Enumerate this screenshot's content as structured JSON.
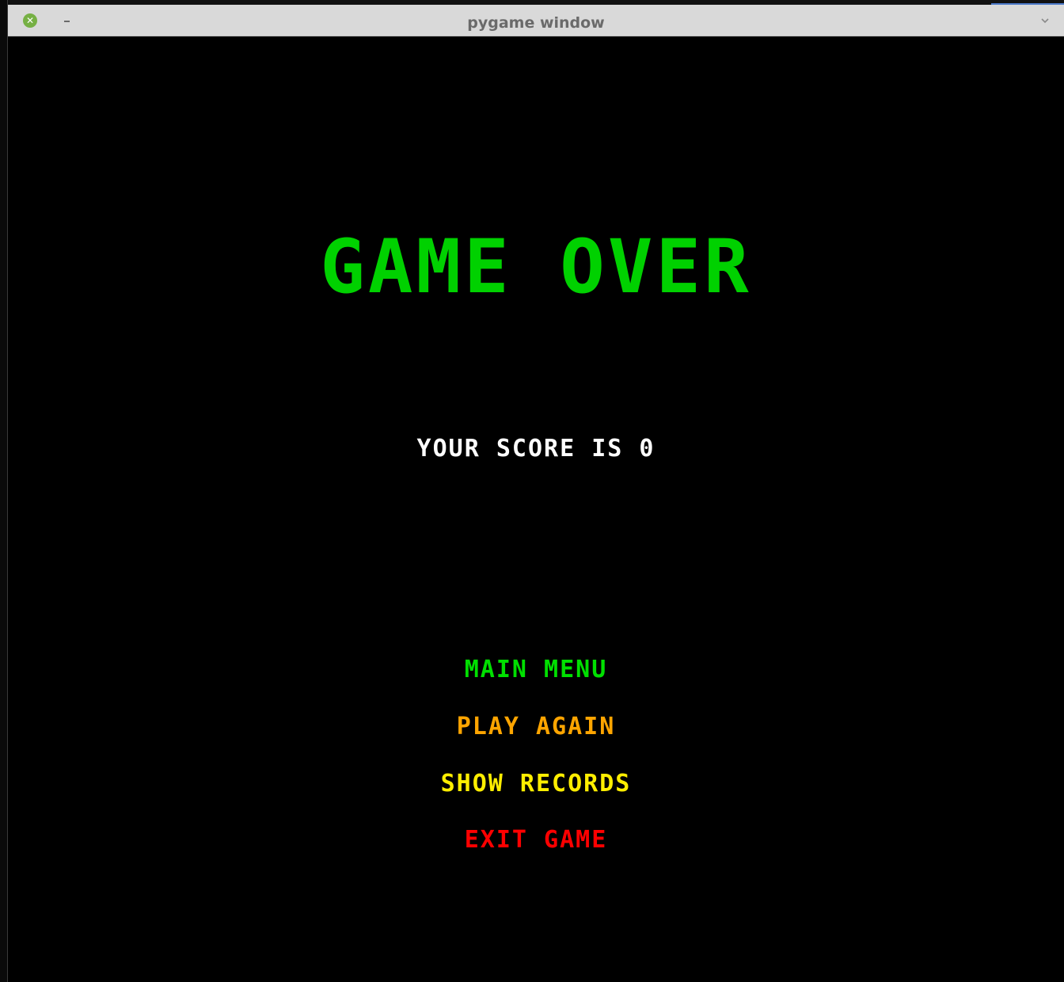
{
  "window": {
    "title": "pygame window"
  },
  "titlebar": {
    "close_icon": "close-circle-icon",
    "close_glyph": "✕",
    "minimize_icon": "minimize-icon",
    "menu_icon": "chevron-down-icon"
  },
  "game": {
    "headline": "GAME OVER",
    "score_text": "YOUR SCORE IS 0",
    "menu": [
      {
        "label": "MAIN MENU",
        "color": "#00e000"
      },
      {
        "label": "PLAY AGAIN",
        "color": "#ffa500"
      },
      {
        "label": "SHOW RECORDS",
        "color": "#ffee00"
      },
      {
        "label": "EXIT GAME",
        "color": "#ff0000"
      }
    ]
  },
  "colors": {
    "headline": "#00d100",
    "score": "#ffffff",
    "background": "#000000",
    "titlebar": "#d9d9d9",
    "close_button": "#76b044"
  }
}
